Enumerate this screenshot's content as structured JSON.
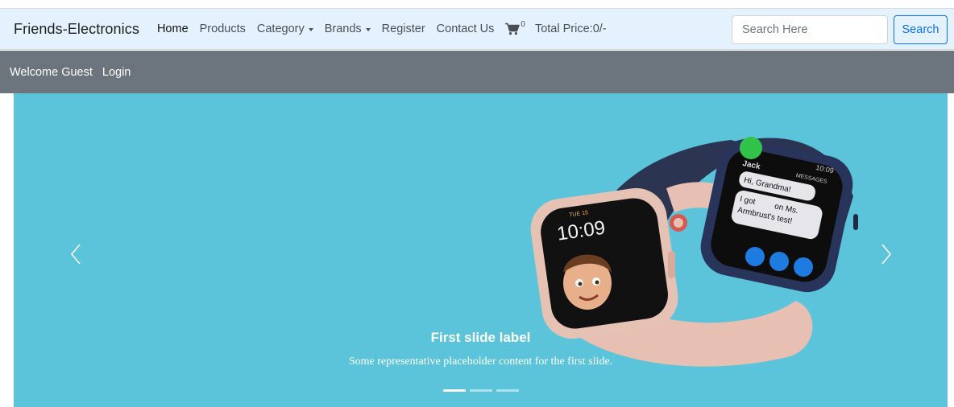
{
  "navbar": {
    "brand": "Friends-Electronics",
    "links": {
      "home": "Home",
      "products": "Products",
      "category": "Category",
      "brands": "Brands",
      "register": "Register",
      "contact": "Contact Us"
    },
    "cart_icon": "cart-icon",
    "cart_count": "0",
    "total_price": "Total Price:0/-",
    "search": {
      "placeholder": "Search Here",
      "value": "",
      "button": "Search"
    }
  },
  "subbar": {
    "welcome": "Welcome Guest",
    "login": "Login"
  },
  "carousel": {
    "caption_title": "First slide label",
    "caption_text": "Some representative placeholder content for the first slide.",
    "slide_count": 3,
    "active_slide": 1,
    "prev_icon": "chevron-left-icon",
    "next_icon": "chevron-right-icon",
    "watch_screen_left": {
      "day": "TUE 15",
      "time": "10:09"
    },
    "watch_screen_right": {
      "contact": "Jack",
      "app": "MESSAGES",
      "time": "10:09",
      "bubble1": "Hi, Grandma!",
      "bubble2a": "I got",
      "bubble2b": "on Ms.",
      "bubble2c": "Armbrust's test!"
    }
  },
  "colors": {
    "navbar_bg": "#e3f2fd",
    "subbar_bg": "#6c757d",
    "carousel_bg": "#5bc4da",
    "accent": "#0d6efd"
  }
}
